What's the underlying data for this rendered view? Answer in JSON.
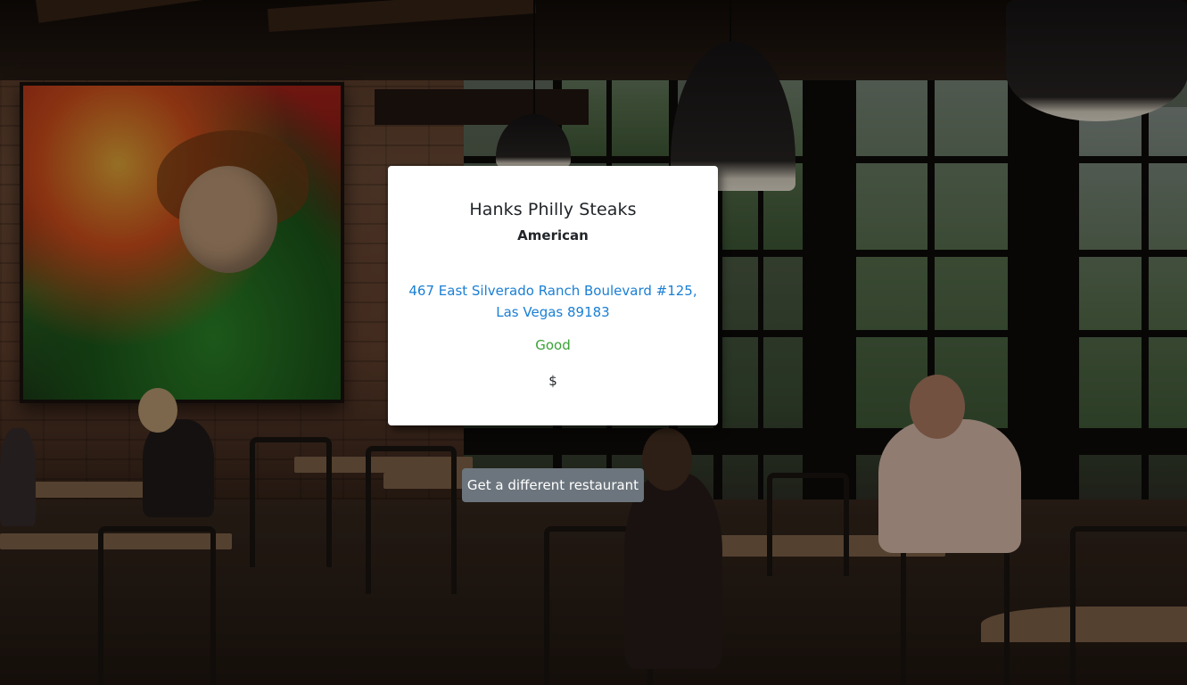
{
  "restaurant": {
    "name": "Hanks Philly Steaks",
    "cuisine": "American",
    "address_line1": "467 East Silverado Ranch Boulevard #125,",
    "address_line2": "Las Vegas 89183",
    "rating": "Good",
    "price": "$"
  },
  "actions": {
    "next_label": "Get a different restaurant"
  },
  "colors": {
    "link": "#1a7fd4",
    "rating": "#3aa337",
    "button": "#6c757d",
    "card": "#ffffff"
  }
}
